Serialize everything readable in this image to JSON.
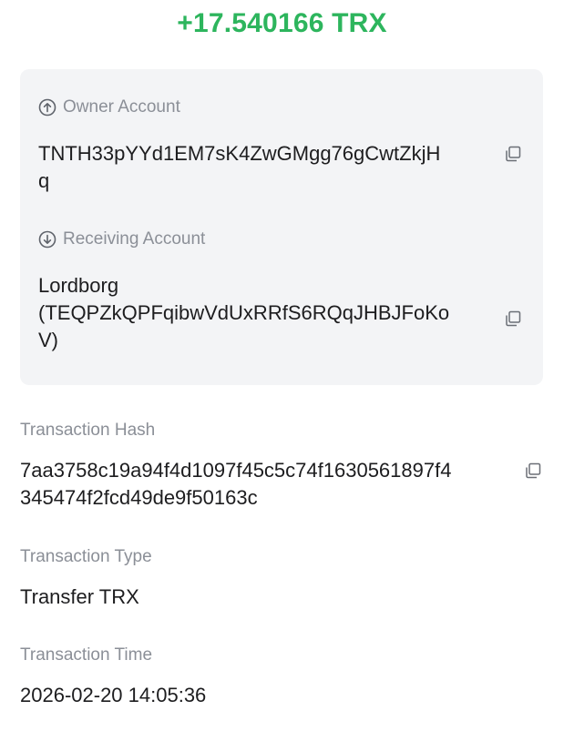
{
  "amount": "+17.540166 TRX",
  "owner": {
    "label": "Owner Account",
    "address_line1": "TNTH33pYYd1EM7sK4ZwGMgg76gCwtZkjH",
    "address_line2": "q",
    "icon": "arrow-up-circle-icon"
  },
  "receiving": {
    "label": "Receiving Account",
    "name": "Lordborg",
    "address_line1": "(TEQPZkQPFqibwVdUxRRfS6RQqJHBJFoKo",
    "address_line2": "V)",
    "icon": "arrow-down-circle-icon"
  },
  "hash": {
    "label": "Transaction Hash",
    "line1": "7aa3758c19a94f4d1097f45c5c74f1630561897f4",
    "line2": "345474f2fcd49de9f50163c"
  },
  "type": {
    "label": "Transaction Type",
    "value": "Transfer TRX"
  },
  "time": {
    "label": "Transaction Time",
    "value": "2026-02-20 14:05:36"
  },
  "colors": {
    "amount": "#2db55d",
    "label": "#8b8f97",
    "card_bg": "#f3f4f6"
  }
}
